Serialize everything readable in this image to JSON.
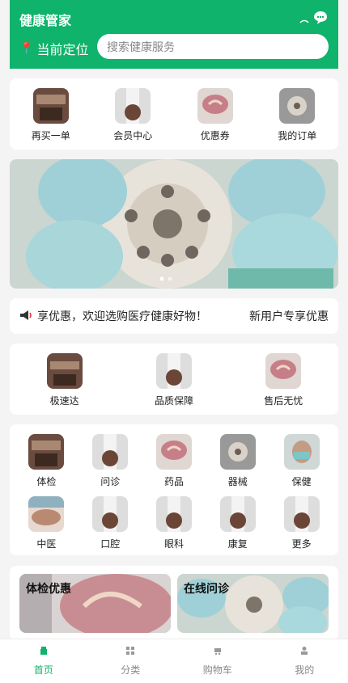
{
  "header": {
    "title": "健康管家",
    "location_label": "当前定位",
    "search_placeholder": "搜索健康服务",
    "icons": [
      "signal-icon",
      "chat-bubble-icon"
    ]
  },
  "quick_actions": [
    {
      "label": "再买一单",
      "icon": "repeat-order-image"
    },
    {
      "label": "会员中心",
      "icon": "member-center-image"
    },
    {
      "label": "优惠券",
      "icon": "coupon-image"
    },
    {
      "label": "我的订单",
      "icon": "my-orders-image"
    }
  ],
  "notice": {
    "text": "享优惠，欢迎选购医疗健康好物！",
    "right_text": "新用户专享优惠"
  },
  "guarantees": [
    {
      "label": "极速达",
      "icon": "fast-delivery-image"
    },
    {
      "label": "品质保障",
      "icon": "quality-assurance-image"
    },
    {
      "label": "售后无忧",
      "icon": "after-sales-image"
    }
  ],
  "categories": [
    {
      "label": "体检"
    },
    {
      "label": "问诊"
    },
    {
      "label": "药品"
    },
    {
      "label": "器械"
    },
    {
      "label": "保健"
    },
    {
      "label": "中医"
    },
    {
      "label": "口腔"
    },
    {
      "label": "眼科"
    },
    {
      "label": "康复"
    },
    {
      "label": "更多"
    }
  ],
  "promos": [
    {
      "title": "体检优惠"
    },
    {
      "title": "在线问诊"
    }
  ],
  "tabs": [
    {
      "label": "首页",
      "icon": "home-icon",
      "active": true
    },
    {
      "label": "分类",
      "icon": "category-icon",
      "active": false
    },
    {
      "label": "购物车",
      "icon": "cart-icon",
      "active": false
    },
    {
      "label": "我的",
      "icon": "profile-icon",
      "active": false
    }
  ],
  "colors": {
    "primary": "#0fb36b"
  }
}
